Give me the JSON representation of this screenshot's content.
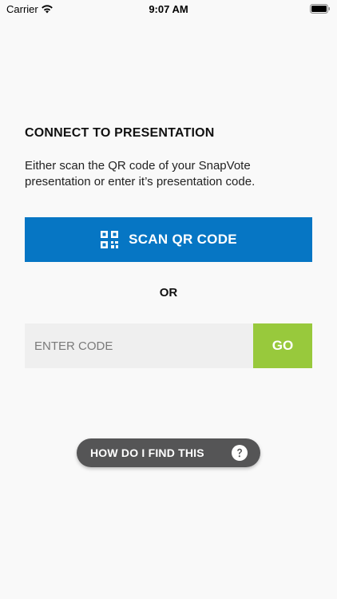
{
  "status_bar": {
    "carrier": "Carrier",
    "time": "9:07 AM",
    "icons": [
      "wifi-icon",
      "battery-icon"
    ]
  },
  "connect": {
    "heading": "CONNECT TO PRESENTATION",
    "description": "Either scan the QR code of your SnapVote presentation or enter it’s presentation code.",
    "scan_button": {
      "label": "SCAN QR CODE",
      "icon": "qr-code-icon"
    },
    "or_label": "OR",
    "code_input": {
      "value": "",
      "placeholder": "ENTER CODE"
    },
    "go_button_label": "GO",
    "help_button": {
      "label": "HOW DO I FIND THIS",
      "icon": "question-icon"
    }
  },
  "colors": {
    "background": "#f9f9f9",
    "scan_button": "#0676c4",
    "go_button": "#98c93c",
    "help_button": "#555556",
    "input_background": "#efefef"
  }
}
